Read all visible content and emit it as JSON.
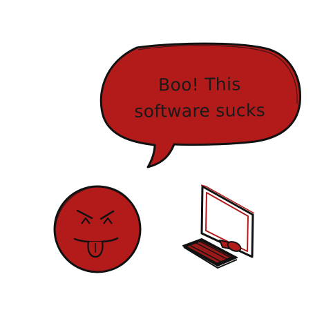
{
  "speech_bubble": {
    "line1": "Boo! This",
    "line2": "software sucks"
  },
  "colors": {
    "fill_red": "#b31b1b",
    "ink": "#111111",
    "background": "#ffffff"
  },
  "icons": {
    "face": "angry-face-icon",
    "monitor": "monitor-icon",
    "keyboard": "keyboard-icon",
    "mouse": "mouse-icon"
  }
}
